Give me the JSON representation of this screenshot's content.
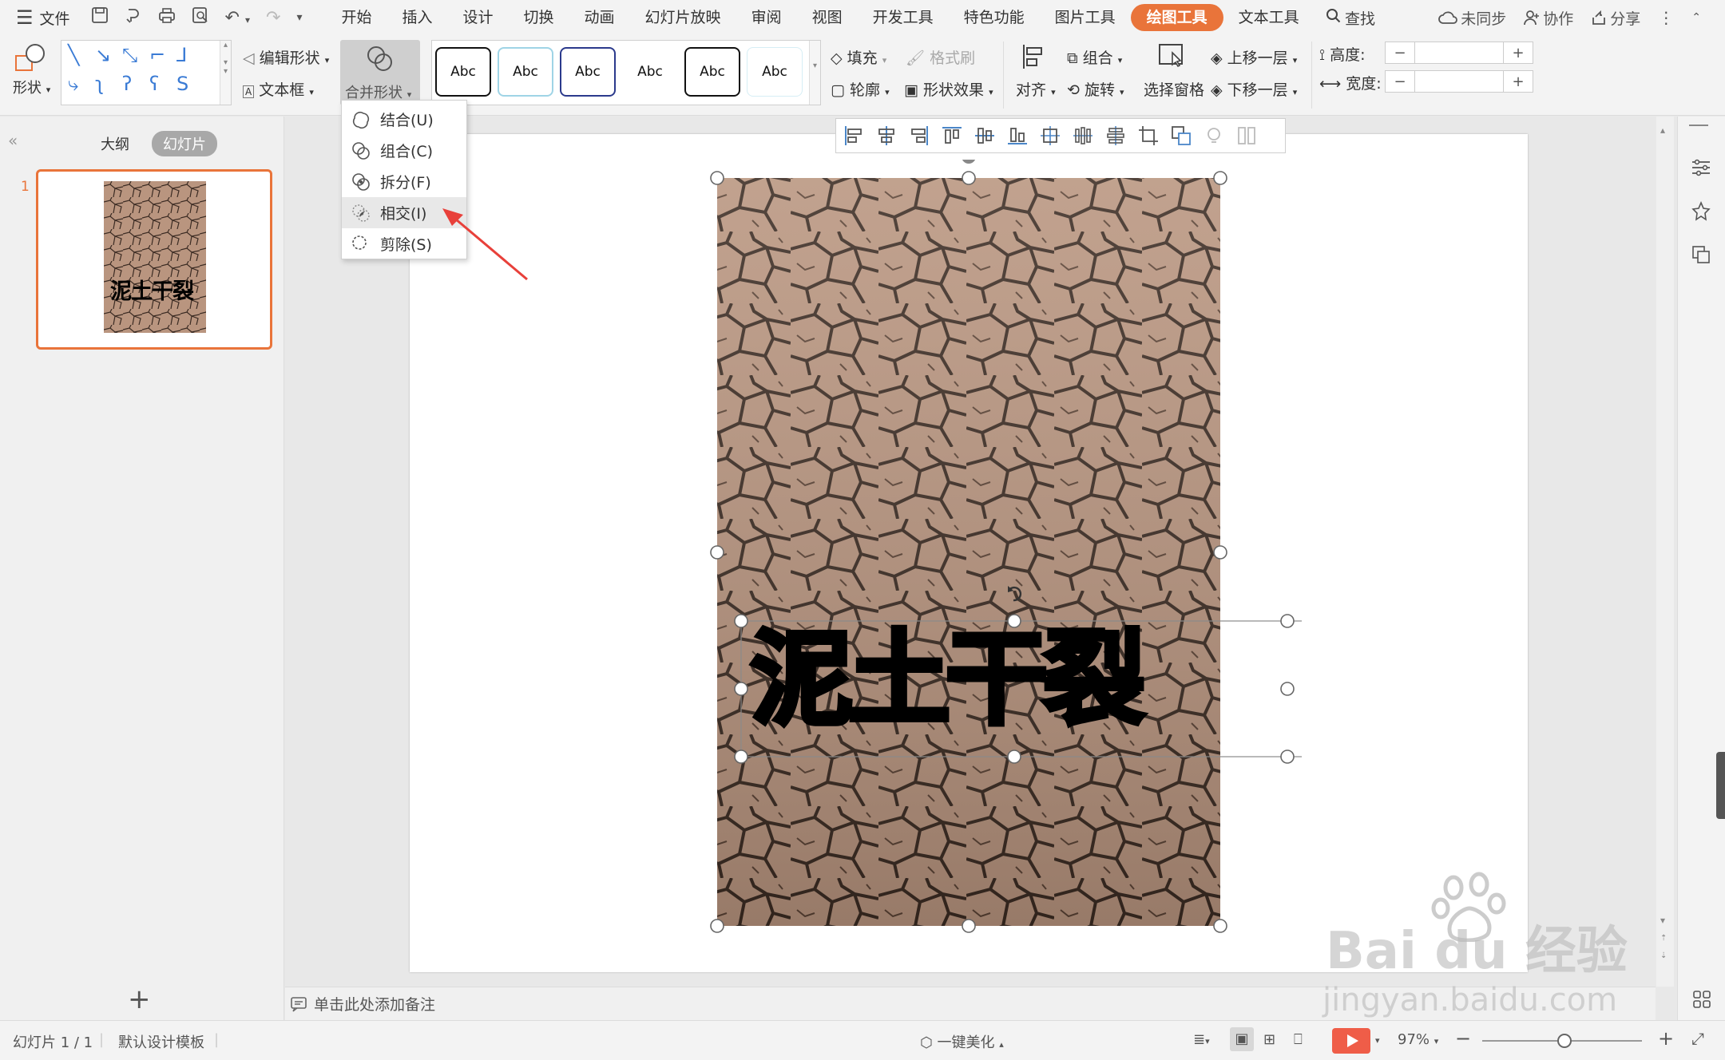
{
  "menubar": {
    "file_label": "文件",
    "tabs": [
      "开始",
      "插入",
      "设计",
      "切换",
      "动画",
      "幻灯片放映",
      "审阅",
      "视图",
      "开发工具",
      "特色功能",
      "图片工具",
      "绘图工具",
      "文本工具"
    ],
    "active_tab": "绘图工具",
    "search_label": "查找",
    "sync_label": "未同步",
    "collab_label": "协作",
    "share_label": "分享"
  },
  "ribbon": {
    "shape_label": "形状",
    "edit_shape_label": "编辑形状",
    "textbox_label": "文本框",
    "merge_shape_label": "合并形状",
    "style_samples": [
      "Abc",
      "Abc",
      "Abc",
      "Abc",
      "Abc",
      "Abc"
    ],
    "fill_label": "填充",
    "format_painter_label": "格式刷",
    "outline_label": "轮廓",
    "shape_effect_label": "形状效果",
    "align_label": "对齐",
    "group_label": "组合",
    "rotate_label": "旋转",
    "selection_pane_label": "选择窗格",
    "bring_forward_label": "上移一层",
    "send_backward_label": "下移一层",
    "height_label": "高度:",
    "width_label": "宽度:",
    "height_value": "",
    "width_value": ""
  },
  "merge_menu": {
    "items": [
      {
        "label": "结合(U)"
      },
      {
        "label": "组合(C)"
      },
      {
        "label": "拆分(F)"
      },
      {
        "label": "相交(I)"
      },
      {
        "label": "剪除(S)"
      }
    ],
    "highlighted": "相交(I)"
  },
  "left_panel": {
    "outline_tab": "大纲",
    "slides_tab": "幻灯片",
    "slide_number": "1",
    "thumb_text": "泥土干裂"
  },
  "slide": {
    "title_text": "泥土干裂"
  },
  "notes": {
    "placeholder": "单击此处添加备注"
  },
  "status": {
    "slide_info": "幻灯片 1 / 1",
    "template": "默认设计模板",
    "beautify": "一键美化",
    "zoom": "97%"
  },
  "watermark": {
    "brand": "Bai du 经验",
    "url": "jingyan.baidu.com"
  },
  "colors": {
    "accent": "#e9743a",
    "arrow": "#e8403a",
    "play": "#ef5d48",
    "mud": "#b9957f"
  }
}
